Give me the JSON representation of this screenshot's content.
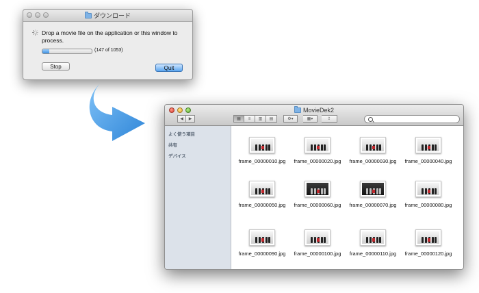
{
  "download_window": {
    "title": "ダウンロード",
    "message": "Drop a movie file on the application or this window to process.",
    "progress_fraction": 0.14,
    "progress_count": "(147 of 1053)",
    "stop_label": "Stop",
    "quit_label": "Quit"
  },
  "finder_window": {
    "title": "MovieDek2",
    "sidebar": [
      "よく使う項目",
      "共有",
      "デバイス"
    ],
    "files": [
      {
        "name": "frame_00000010.jpg",
        "style": "light"
      },
      {
        "name": "frame_00000020.jpg",
        "style": "light"
      },
      {
        "name": "frame_00000030.jpg",
        "style": "light"
      },
      {
        "name": "frame_00000040.jpg",
        "style": "light"
      },
      {
        "name": "frame_00000050.jpg",
        "style": "mixed"
      },
      {
        "name": "frame_00000060.jpg",
        "style": "dark"
      },
      {
        "name": "frame_00000070.jpg",
        "style": "dark"
      },
      {
        "name": "frame_00000080.jpg",
        "style": "light"
      },
      {
        "name": "frame_00000090.jpg",
        "style": "light"
      },
      {
        "name": "frame_00000100.jpg",
        "style": "light"
      },
      {
        "name": "frame_00000110.jpg",
        "style": "light"
      },
      {
        "name": "frame_00000120.jpg",
        "style": "light"
      }
    ]
  },
  "colors": {
    "arrow": "#4a9be6",
    "progress_fill": "#3b8ee0",
    "quit_button": "#5aa5ef"
  }
}
